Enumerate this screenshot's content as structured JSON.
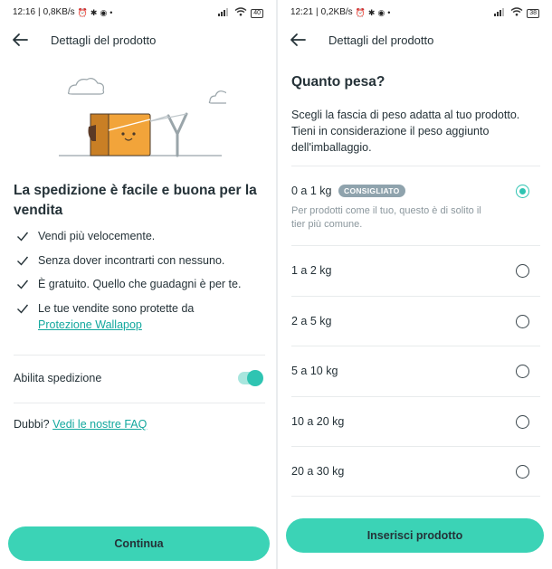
{
  "left": {
    "status": {
      "time": "12:16",
      "speed": "0,8KB/s",
      "battery": "40"
    },
    "header_title": "Dettagli del prodotto",
    "headline": "La spedizione è facile e buona per la vendita",
    "benefits": [
      {
        "text": "Vendi più velocemente."
      },
      {
        "text": "Senza dover incontrarti con nessuno."
      },
      {
        "text": "È gratuito. Quello che guadagni è per te."
      },
      {
        "text": "Le tue vendite sono protette da",
        "link": "Protezione Wallapop"
      }
    ],
    "toggle_label": "Abilita spedizione",
    "toggle_on": true,
    "faq_prefix": "Dubbi?",
    "faq_link": "Vedi le nostre FAQ",
    "continue_label": "Continua"
  },
  "right": {
    "status": {
      "time": "12:21",
      "speed": "0,2KB/s",
      "battery": "38"
    },
    "header_title": "Dettagli del prodotto",
    "title": "Quanto pesa?",
    "description": "Scegli la fascia di peso adatta al tuo prodotto. Tieni in considerazione il peso aggiunto dell'imballaggio.",
    "options": [
      {
        "label": "0 a 1 kg",
        "badge": "CONSIGLIATO",
        "hint": "Per prodotti come il tuo, questo è di solito il tier più comune.",
        "selected": true
      },
      {
        "label": "1 a 2 kg",
        "selected": false
      },
      {
        "label": "2 a 5 kg",
        "selected": false
      },
      {
        "label": "5 a 10 kg",
        "selected": false
      },
      {
        "label": "10 a 20 kg",
        "selected": false
      },
      {
        "label": "20 a 30 kg",
        "selected": false
      }
    ],
    "insert_label": "Inserisci prodotto"
  },
  "colors": {
    "accent": "#3bd3b6",
    "accent_dark": "#2fc4b2",
    "link": "#13a89e",
    "badge": "#8fa3ad",
    "text": "#253238"
  },
  "icons": [
    "back-arrow-icon",
    "check-icon",
    "radio-icon",
    "cloud-icon",
    "box-icon",
    "slingshot-icon",
    "wifi-icon",
    "signal-icon",
    "battery-icon",
    "alarm-icon",
    "bluetooth-icon"
  ]
}
